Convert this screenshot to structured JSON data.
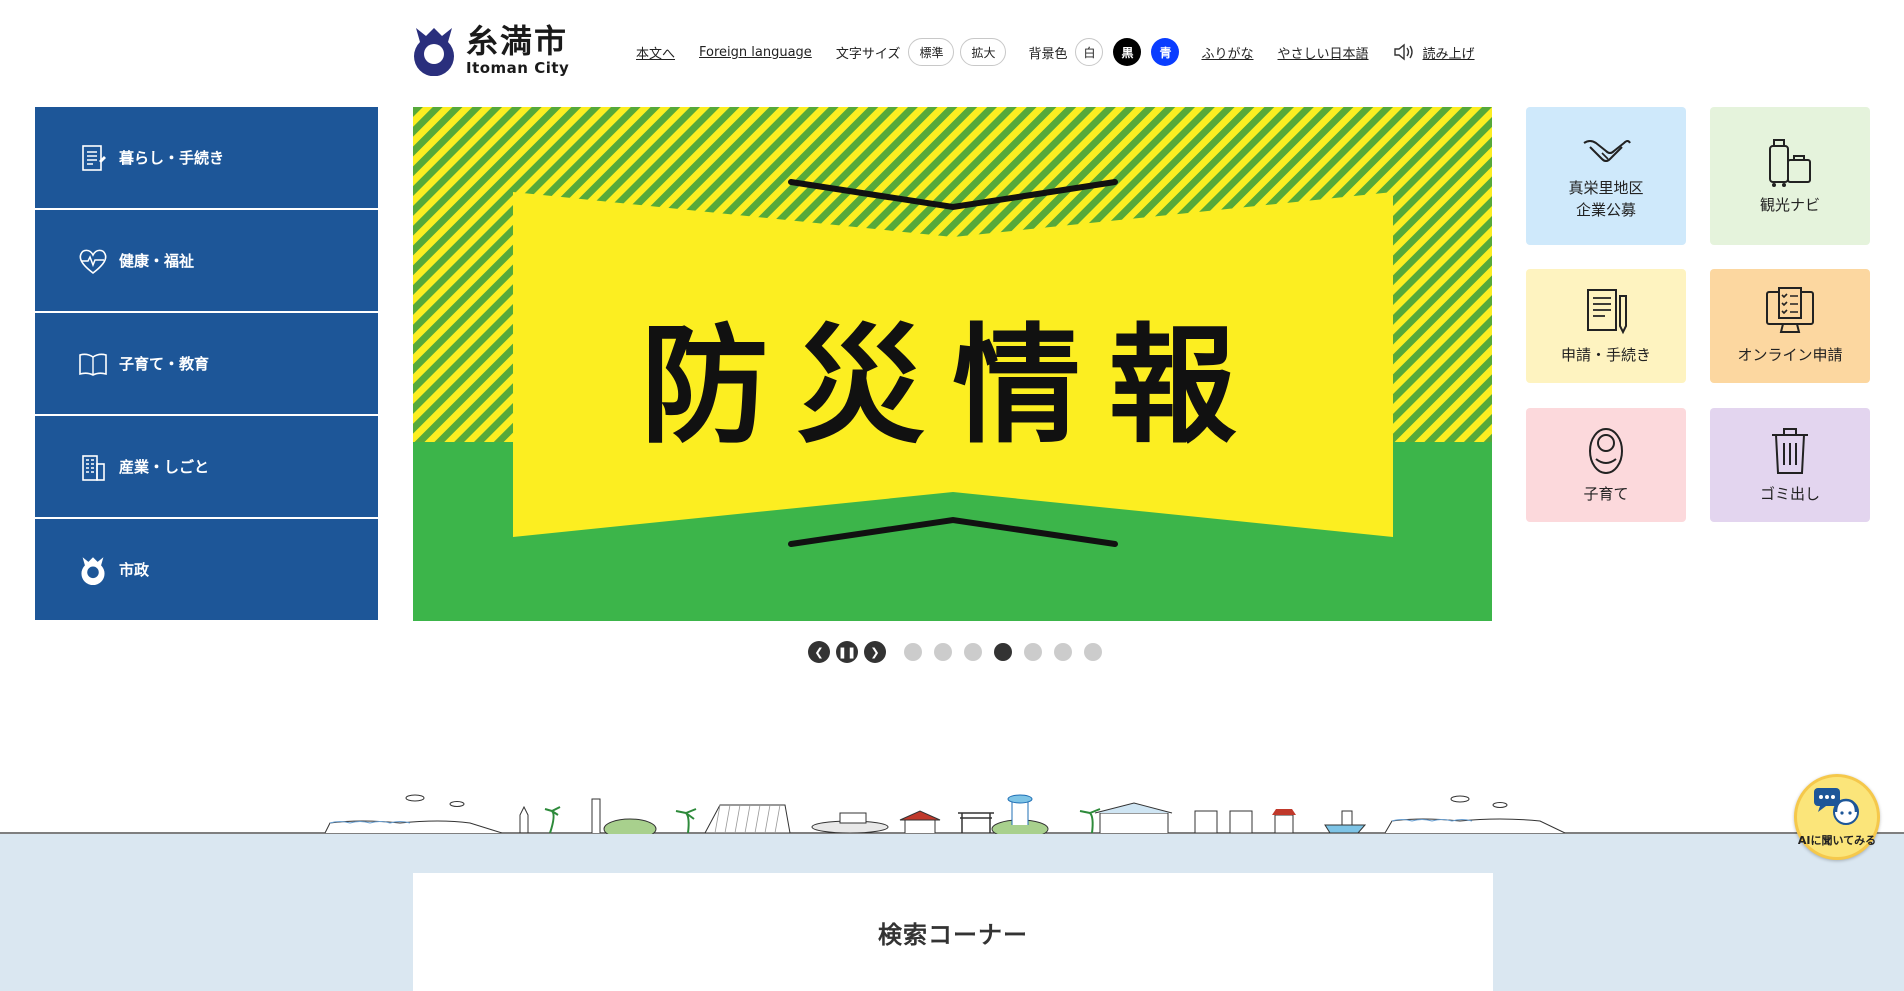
{
  "header": {
    "logo": {
      "name": "糸満市",
      "english": "Itoman City"
    },
    "links": {
      "skip_to_content": "本文へ",
      "foreign_language": "Foreign language",
      "furigana": "ふりがな",
      "easy_japanese": "やさしい日本語",
      "read_aloud": "読み上げ"
    },
    "font_size": {
      "label": "文字サイズ",
      "standard": "標準",
      "large": "拡大"
    },
    "background_color": {
      "label": "背景色",
      "white": "白",
      "black": "黒",
      "blue": "青"
    }
  },
  "left_menu": [
    {
      "label": "暮らし・手続き",
      "icon": "document-icon"
    },
    {
      "label": "健康・福祉",
      "icon": "heart-pulse-icon"
    },
    {
      "label": "子育て・教育",
      "icon": "book-icon"
    },
    {
      "label": "産業・しごと",
      "icon": "building-icon"
    },
    {
      "label": "市政",
      "icon": "city-emblem-icon"
    }
  ],
  "hero": {
    "title": "防災情報",
    "colors": {
      "yellow": "#fcee21",
      "green": "#3cb54a",
      "stripe_dark": "#56a93a"
    }
  },
  "carousel": {
    "dot_count": 7,
    "active_index": 3
  },
  "tiles": [
    {
      "label_line1": "真栄里地区",
      "label_line2": "企業公募",
      "icon": "handshake-icon",
      "color": "#cfe9fb"
    },
    {
      "label_line1": "観光ナビ",
      "label_line2": "",
      "icon": "luggage-icon",
      "color": "#e5f3dc"
    },
    {
      "label_line1": "申請・手続き",
      "label_line2": "",
      "icon": "form-pen-icon",
      "color": "#fef3c0"
    },
    {
      "label_line1": "オンライン申請",
      "label_line2": "",
      "icon": "online-form-icon",
      "color": "#fcd7a0"
    },
    {
      "label_line1": "子育て",
      "label_line2": "",
      "icon": "baby-icon",
      "color": "#fcd9dc"
    },
    {
      "label_line1": "ゴミ出し",
      "label_line2": "",
      "icon": "trash-icon",
      "color": "#e3d5ef"
    }
  ],
  "search": {
    "title": "検索コーナー"
  },
  "ai_chat": {
    "label": "AIに聞いてみる"
  },
  "colors": {
    "menu_blue": "#1d5698",
    "band": "#dae7f1"
  }
}
